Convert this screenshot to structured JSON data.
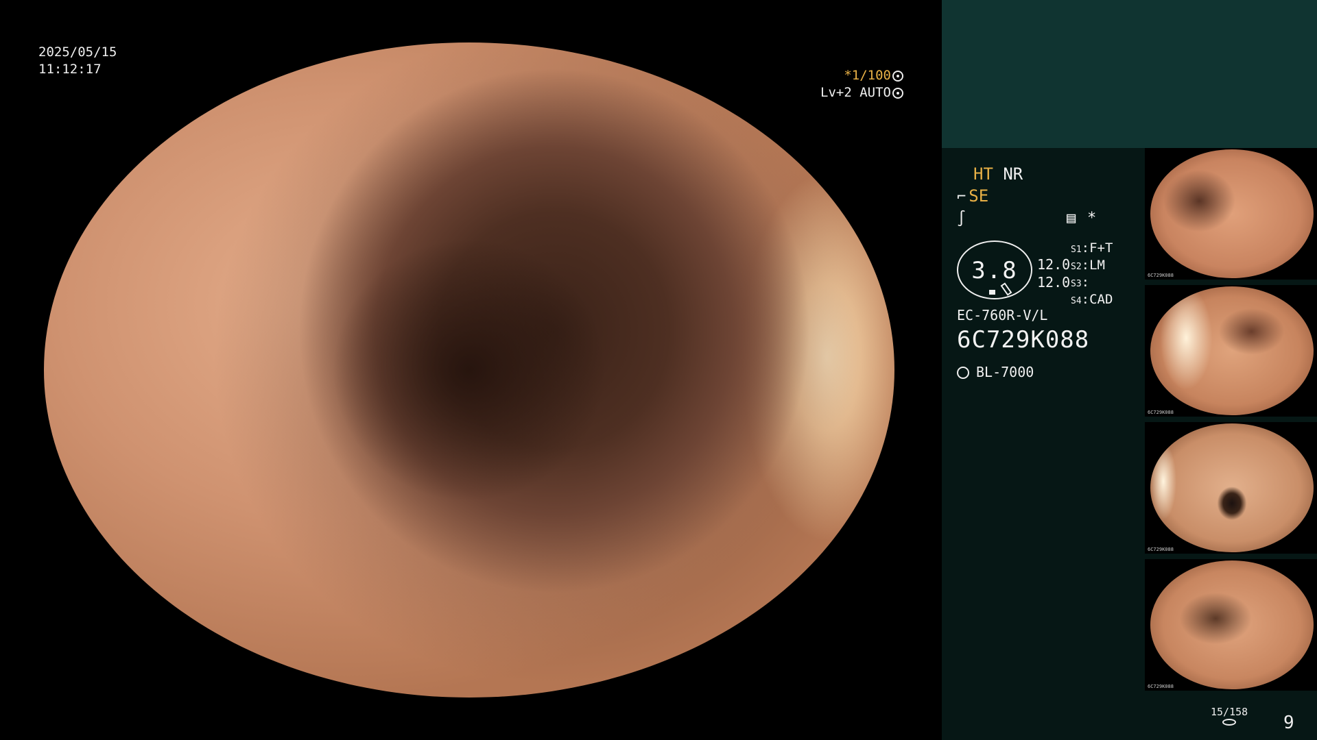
{
  "overlay": {
    "date": "2025/05/15",
    "time": "11:12:17",
    "shutter": "*1/100",
    "level": "Lv+2 AUTO"
  },
  "status": {
    "ht": "HT",
    "nr": "NR",
    "se": "SE",
    "asterisk": "*",
    "zoom": "3.8",
    "value_top": "12.0",
    "value_bottom": "12.0",
    "s1_label": "S1",
    "s1_value": "F+T",
    "s2_label": "S2",
    "s2_value": "LM",
    "s3_label": "S3",
    "s3_value": "",
    "s4_label": "S4",
    "s4_value": "CAD",
    "scope_model": "EC-760R-V/L",
    "serial": "6C729K088",
    "light_source": "BL-7000"
  },
  "thumbnails": [
    {
      "caption": "6C729K088"
    },
    {
      "caption": "6C729K088"
    },
    {
      "caption": "6C729K088"
    },
    {
      "caption": "6C729K088"
    }
  ],
  "footer": {
    "counter": "15/158",
    "page": "9"
  },
  "colors": {
    "panel_dark": "#061715",
    "panel_top": "#103431",
    "accent_amber": "#e8b046",
    "mucosa": "#d99a78"
  }
}
